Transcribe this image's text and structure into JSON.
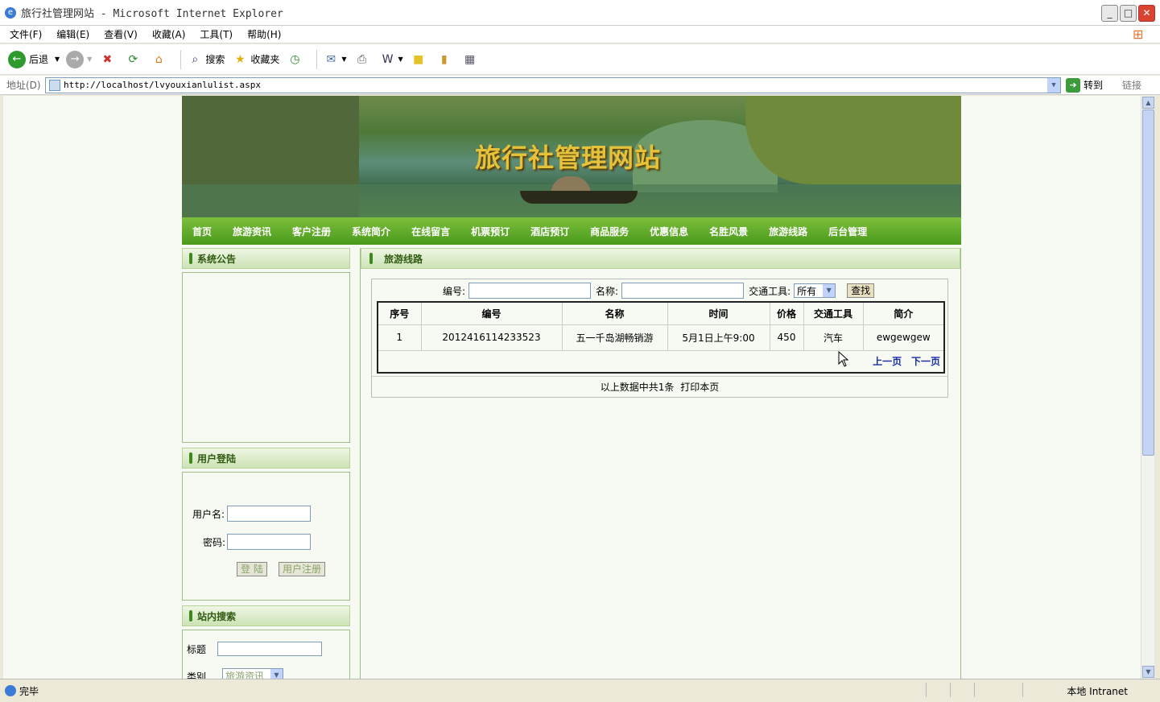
{
  "window": {
    "title": "旅行社管理网站 - Microsoft Internet Explorer"
  },
  "menu": [
    "文件(F)",
    "编辑(E)",
    "查看(V)",
    "收藏(A)",
    "工具(T)",
    "帮助(H)"
  ],
  "toolbar": {
    "back": "后退",
    "search": "搜索",
    "favorites": "收藏夹"
  },
  "address": {
    "label": "地址(D)",
    "url": "http://localhost/lvyouxianlulist.aspx",
    "go": "转到",
    "links": "链接"
  },
  "site": {
    "banner_title": "旅行社管理网站",
    "nav": [
      "首页",
      "旅游资讯",
      "客户注册",
      "系统简介",
      "在线留言",
      "机票预订",
      "酒店预订",
      "商品服务",
      "优惠信息",
      "名胜风景",
      "旅游线路",
      "后台管理"
    ],
    "announce_title": "系统公告",
    "login": {
      "title": "用户登陆",
      "user_label": "用户名:",
      "pass_label": "密码:",
      "login_btn": "登 陆",
      "register_btn": "用户注册"
    },
    "site_search": {
      "title": "站内搜索",
      "title_label": "标题",
      "type_label": "类别",
      "type_value": "旅游资讯"
    },
    "main": {
      "title": "旅游线路",
      "filter": {
        "id_label": "编号:",
        "name_label": "名称:",
        "transport_label": "交通工具:",
        "transport_value": "所有",
        "search_btn": "查找"
      },
      "columns": [
        "序号",
        "编号",
        "名称",
        "时间",
        "价格",
        "交通工具",
        "简介"
      ],
      "rows": [
        {
          "no": "1",
          "id": "2012416114233523",
          "name": "五一千岛湖畅销游",
          "time": "5月1日上午9:00",
          "price": "450",
          "transport": "汽车",
          "intro": "ewgewgew"
        }
      ],
      "prev": "上一页",
      "next": "下一页",
      "summary": "以上数据中共1条",
      "print": "打印本页"
    }
  },
  "status": {
    "text": "完毕",
    "zone": "本地 Intranet"
  }
}
